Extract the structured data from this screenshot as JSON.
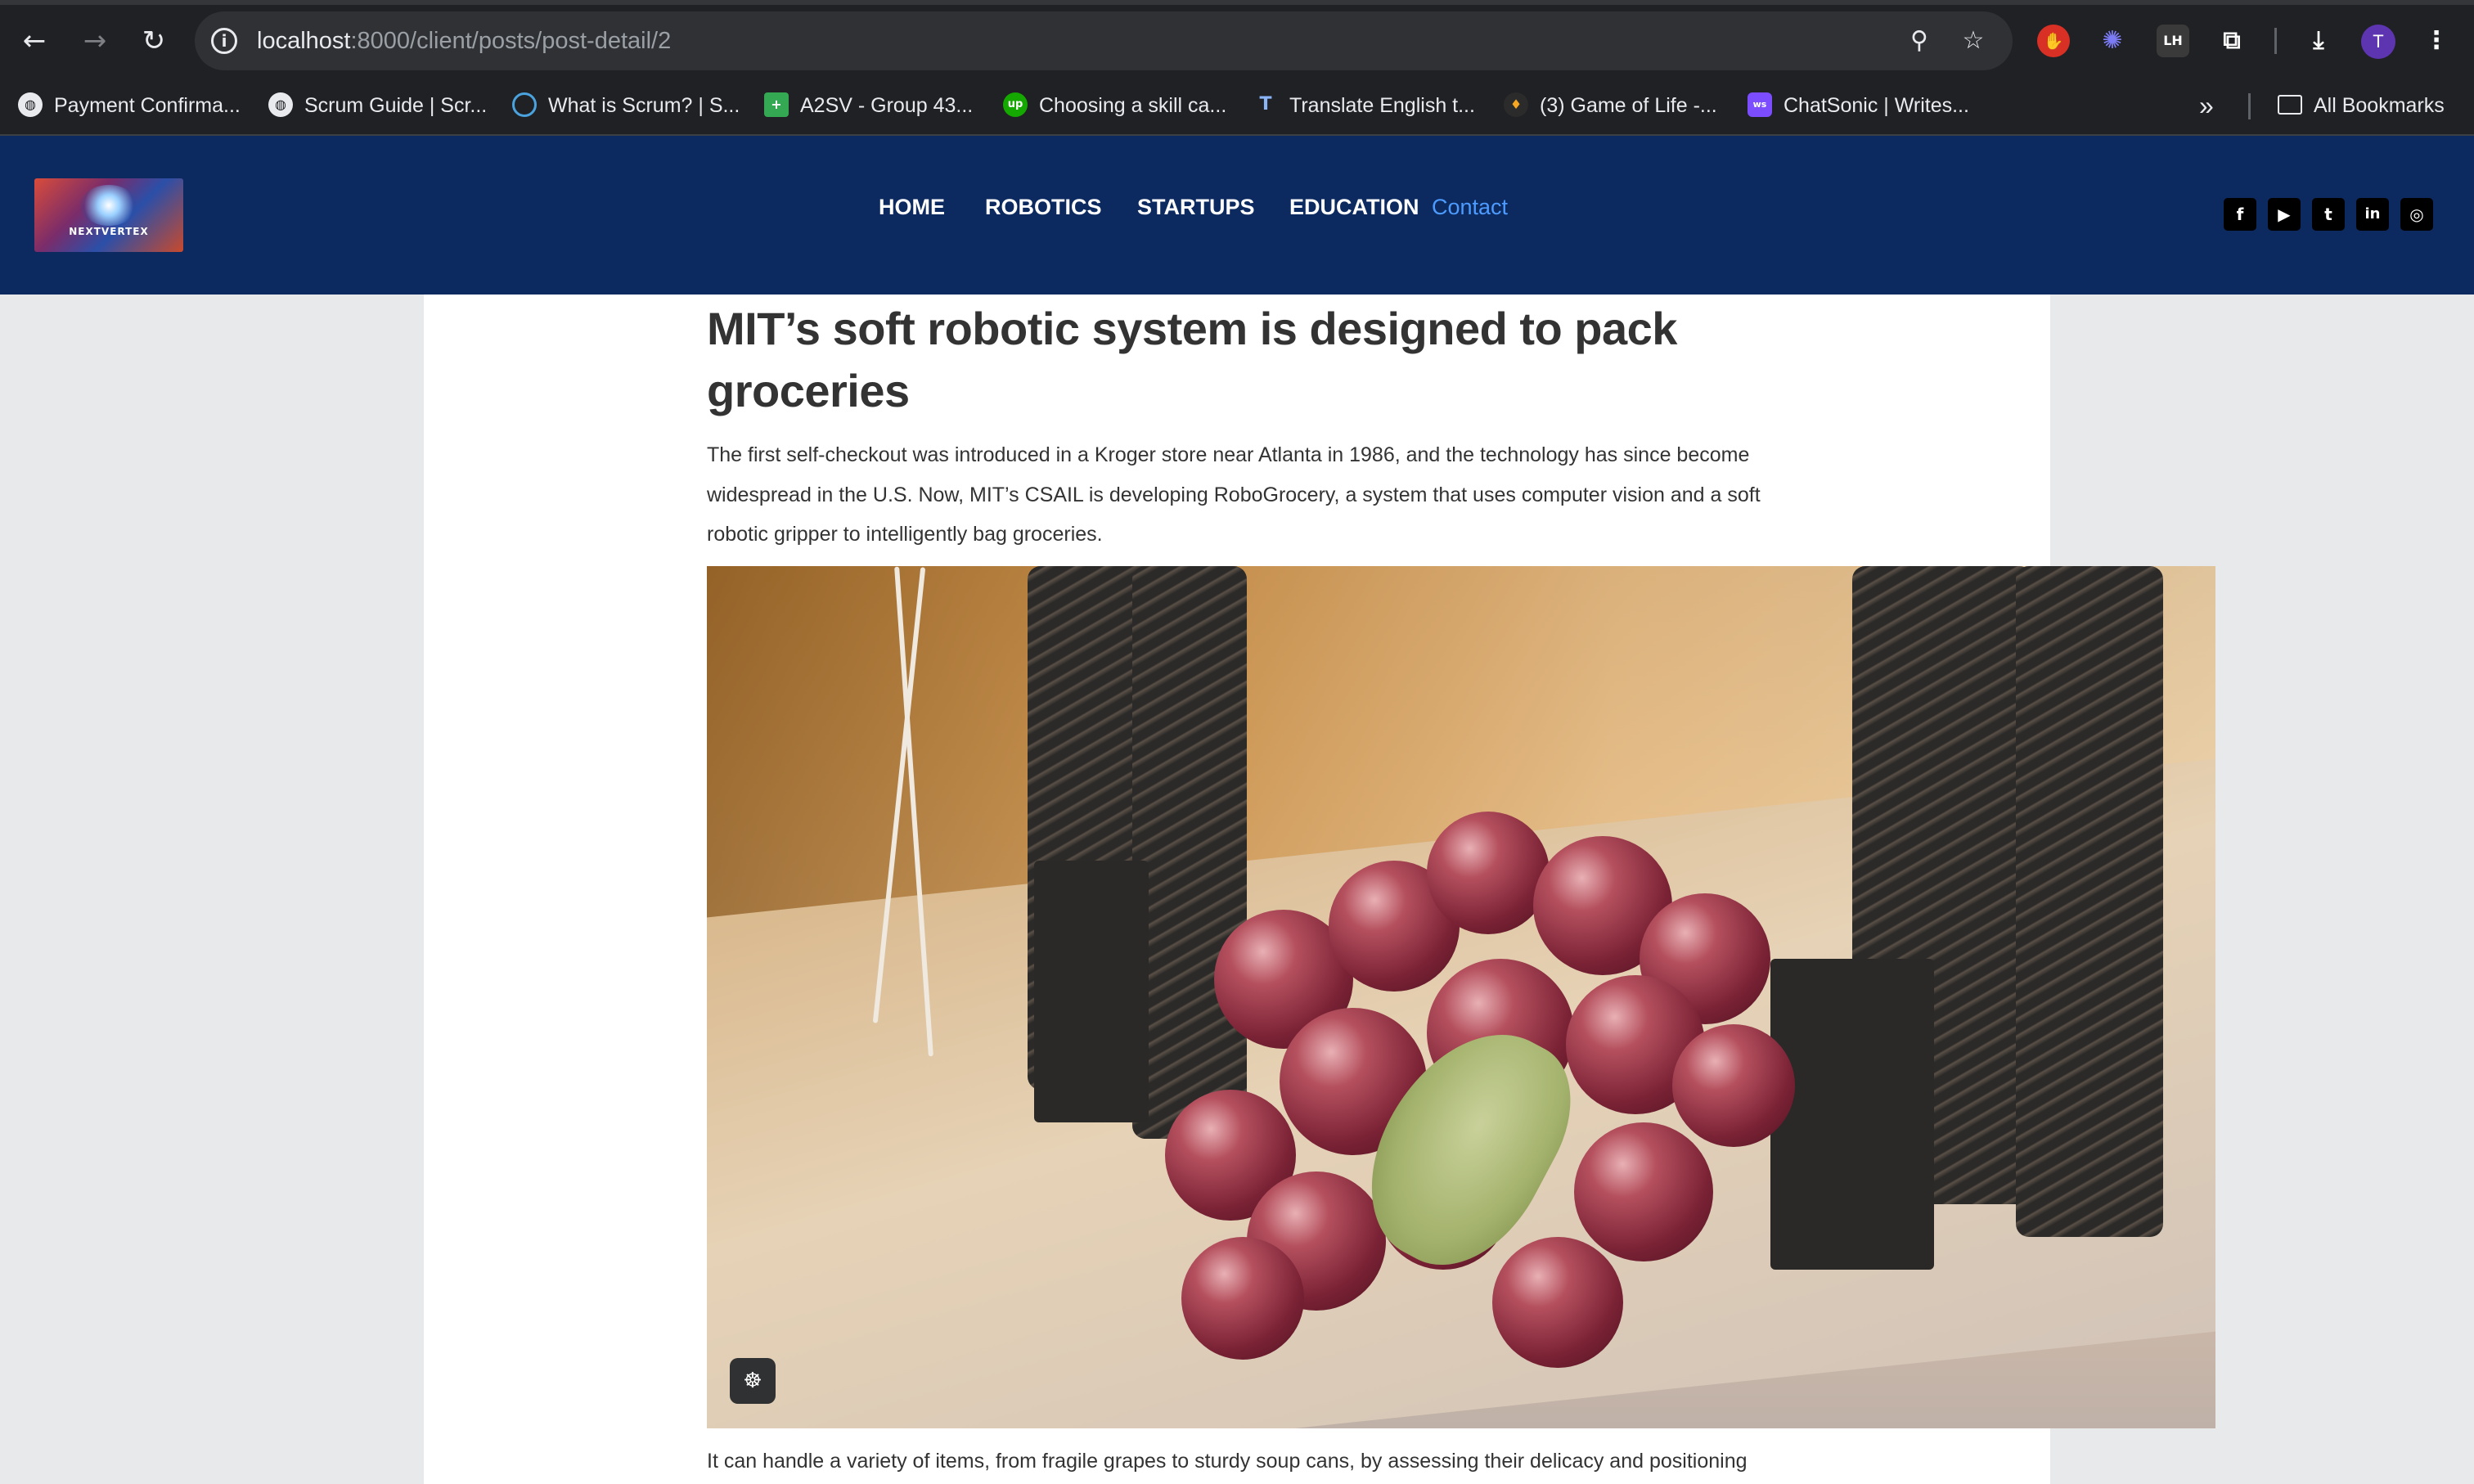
{
  "browser": {
    "url_host": "localhost",
    "url_path": ":8000/client/posts/post-detail/2",
    "profile_initial": "T",
    "bookmarks": [
      {
        "label": "Payment Confirma...",
        "icon": "globe-icon"
      },
      {
        "label": "Scrum Guide | Scr...",
        "icon": "globe-icon"
      },
      {
        "label": "What is Scrum? | S...",
        "icon": "scrum-icon"
      },
      {
        "label": "A2SV - Group 43...",
        "icon": "sheets-icon"
      },
      {
        "label": "Choosing a skill ca...",
        "icon": "upwork-icon"
      },
      {
        "label": "Translate English t...",
        "icon": "translate-icon"
      },
      {
        "label": "(3) Game of Life -...",
        "icon": "flame-icon"
      },
      {
        "label": "ChatSonic | Writes...",
        "icon": "writesonic-icon"
      }
    ],
    "all_bookmarks_label": "All Bookmarks"
  },
  "site": {
    "logo_text": "NEXTVERTEX",
    "nav": {
      "home": "HOME",
      "robotics": "ROBOTICS",
      "startups": "STARTUPS",
      "education": "EDUCATION",
      "contact": "Contact"
    },
    "social": [
      "facebook-icon",
      "youtube-icon",
      "twitter-icon",
      "linkedin-icon",
      "instagram-icon"
    ]
  },
  "article": {
    "title": "MIT’s soft robotic system is designed to pack groceries",
    "lead": "The first self-checkout was introduced in a Kroger store near Atlanta in 1986, and the technology has since become widespread in the U.S. Now, MIT’s CSAIL is developing RoboGrocery, a system that uses computer vision and a soft robotic gripper to intelligently bag groceries.",
    "body_start": "It can handle a variety of items, from fragile grapes to sturdy soup cans, by assessing their delicacy and positioning"
  }
}
